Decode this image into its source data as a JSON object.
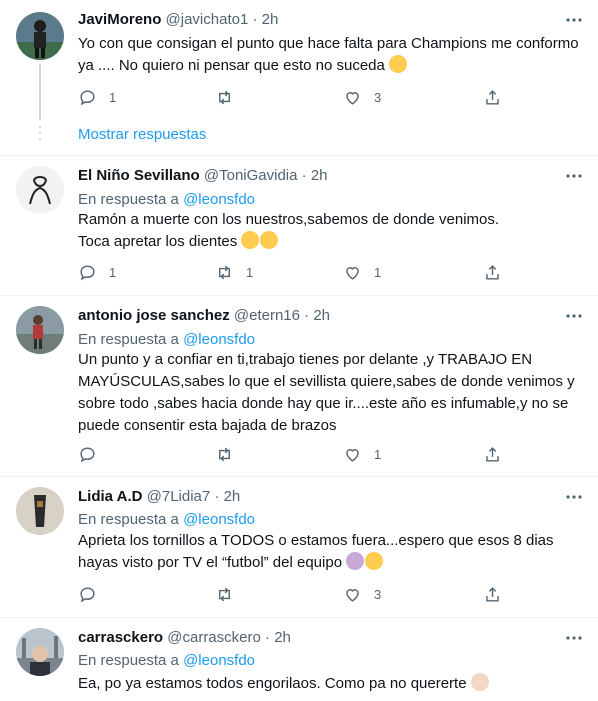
{
  "feed": {
    "thread_link": "Mostrar respuestas",
    "tweets": [
      {
        "name": "JaviMoreno",
        "handle": "@javichato1",
        "dot": "·",
        "time": "2h",
        "reply_label": "",
        "reply_mention": "",
        "lines": [
          "Yo con que consigan el punto que hace falta para Champions me conformo",
          "ya .... No quiero ni pensar que esto no suceda"
        ],
        "reply_count": "1",
        "retweet_count": "",
        "like_count": "3"
      },
      {
        "name": "El Niño Sevillano",
        "handle": "@ToniGavidia",
        "dot": "·",
        "time": "2h",
        "reply_label": "En respuesta a",
        "reply_mention": "@leonsfdo",
        "lines": [
          "Ramón a muerte con los nuestros,sabemos de donde venimos.",
          "Toca apretar los dientes"
        ],
        "reply_count": "1",
        "retweet_count": "1",
        "like_count": "1"
      },
      {
        "name": "antonio jose sanchez",
        "handle": "@etern16",
        "dot": "·",
        "time": "2h",
        "reply_label": "En respuesta a",
        "reply_mention": "@leonsfdo",
        "lines": [
          "Un punto y a confiar en ti,trabajo tienes por delante ,y TRABAJO EN",
          "MAYÚSCULAS,sabes lo que el sevillista quiere,sabes de donde venimos y",
          "sobre todo ,sabes hacia donde hay que ir....este año es infumable,y no se",
          "puede consentir esta bajada de brazos"
        ],
        "reply_count": "",
        "retweet_count": "",
        "like_count": "1"
      },
      {
        "name": "Lidia A.D",
        "handle": "@7Lidia7",
        "dot": "·",
        "time": "2h",
        "reply_label": "En respuesta a",
        "reply_mention": "@leonsfdo",
        "lines": [
          "Aprieta los tornillos a TODOS o estamos fuera...espero que esos 8 dias",
          "hayas visto por TV el “futbol” del equipo"
        ],
        "reply_count": "",
        "retweet_count": "",
        "like_count": "3"
      },
      {
        "name": "carrasckero",
        "handle": "@carrasckero",
        "dot": "·",
        "time": "2h",
        "reply_label": "En respuesta a",
        "reply_mention": "@leonsfdo",
        "lines": [
          "Ea, po ya estamos todos engorilaos. Como pa no quererte"
        ],
        "reply_count": "",
        "retweet_count": "",
        "like_count": ""
      }
    ]
  }
}
